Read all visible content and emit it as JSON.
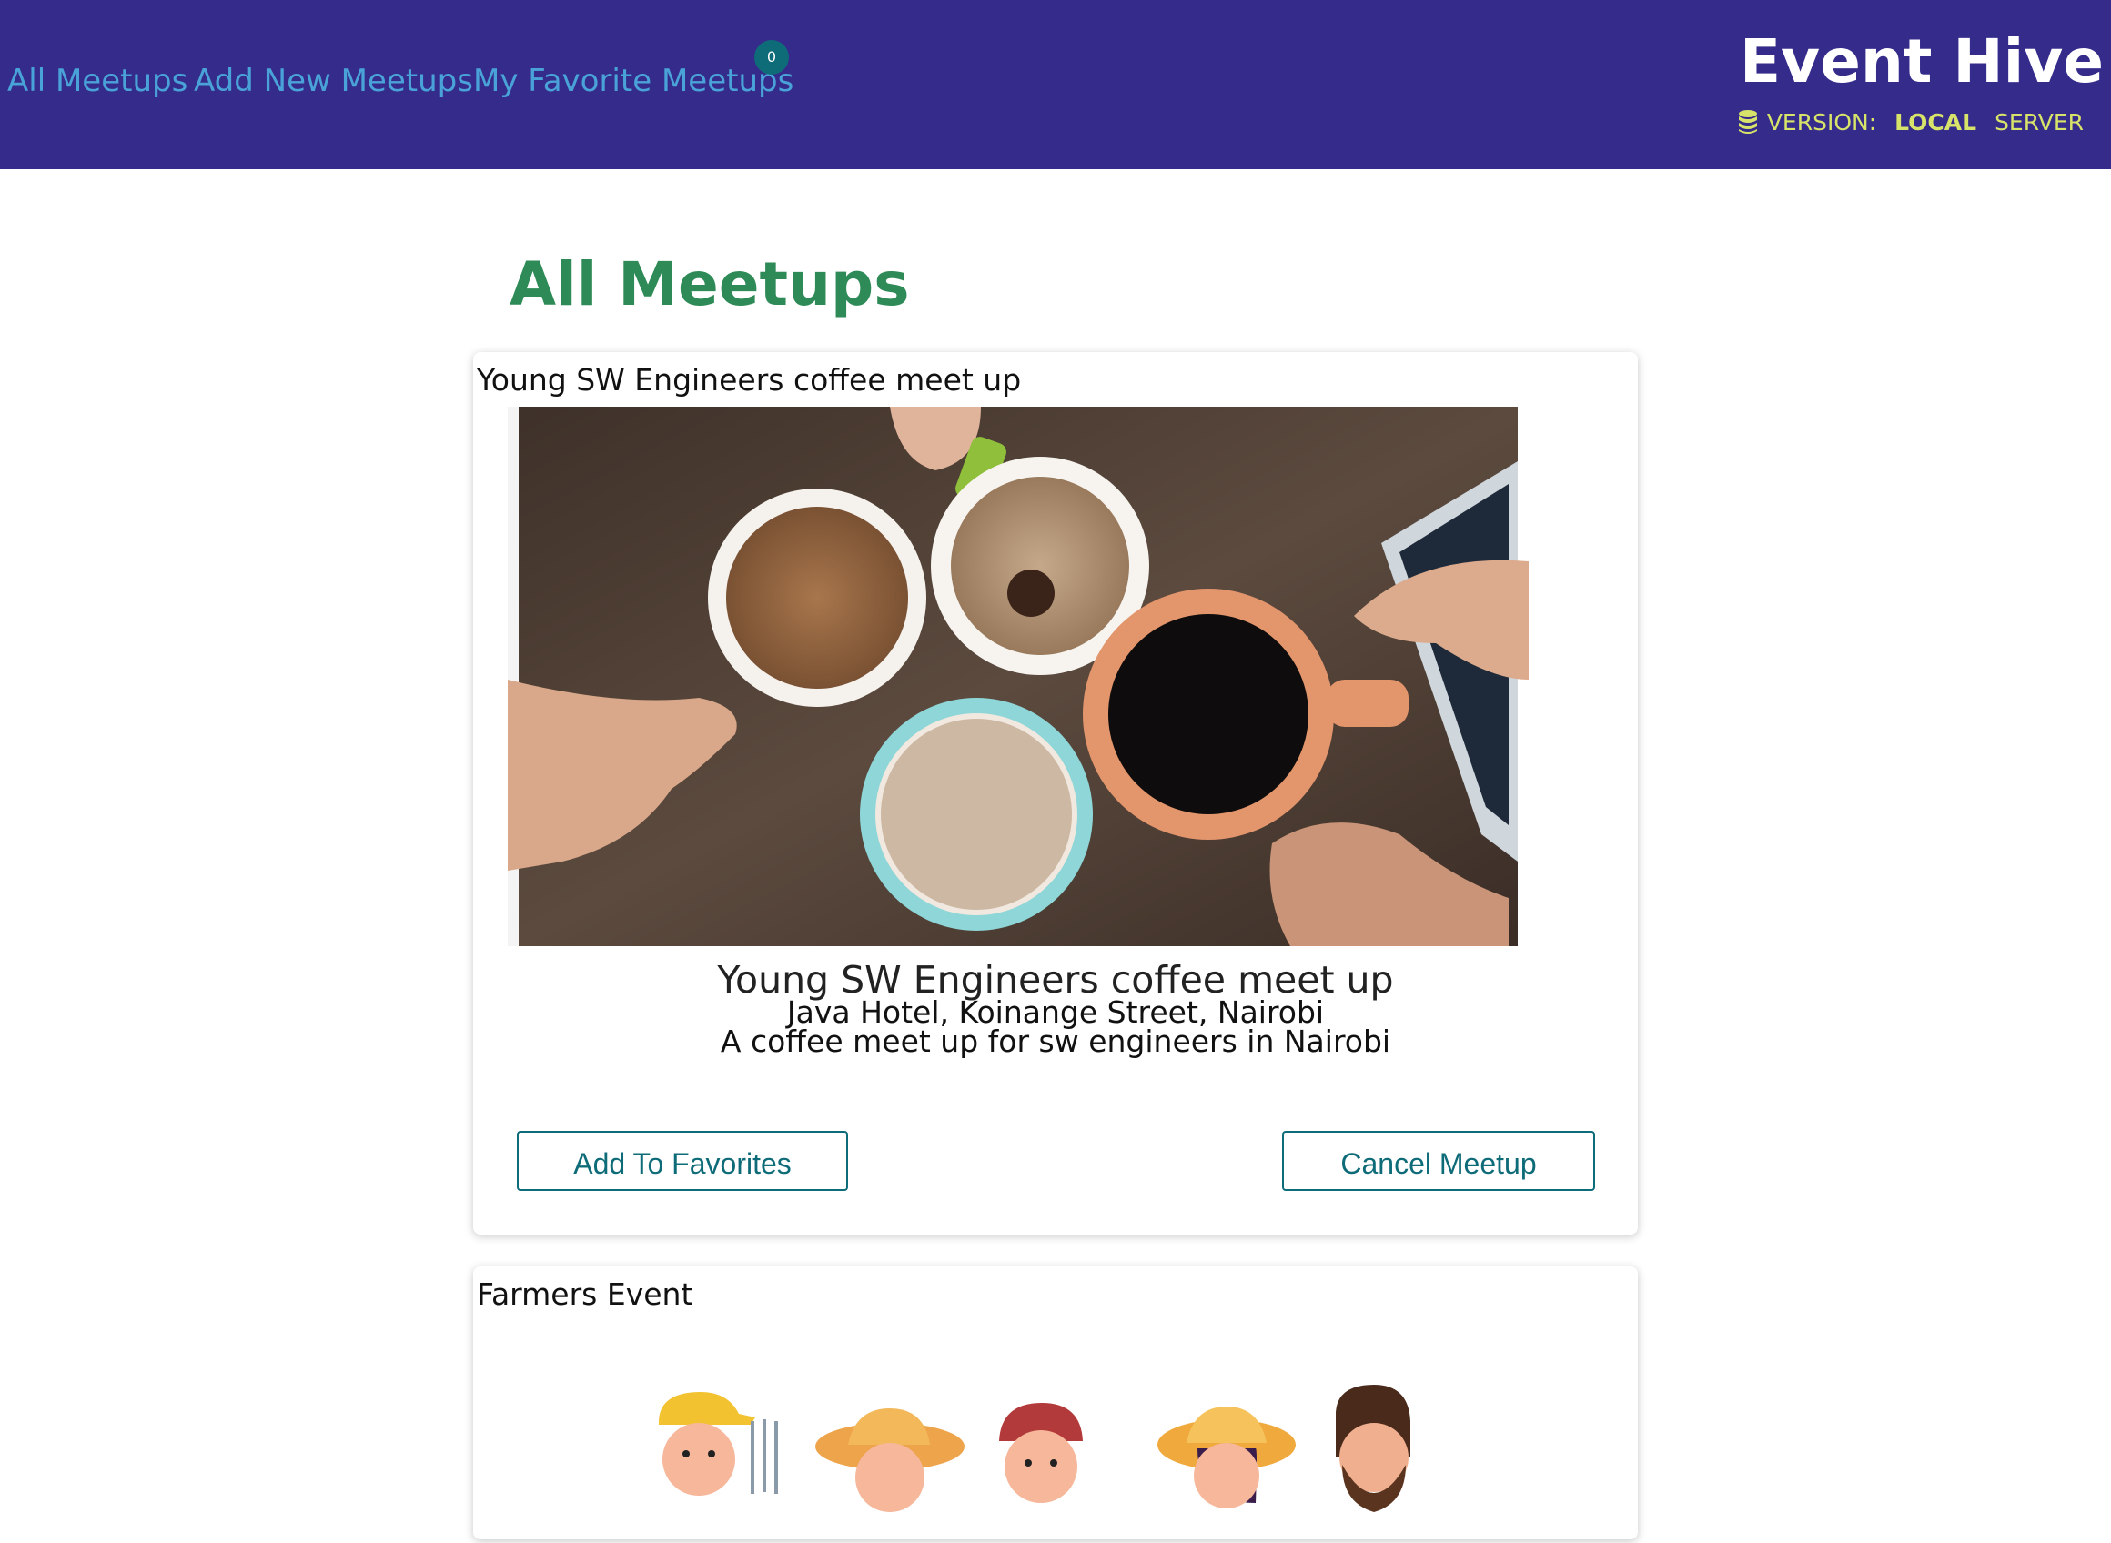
{
  "header": {
    "nav": [
      {
        "label": "All Meetups"
      },
      {
        "label": "Add New Meetups"
      },
      {
        "label": "My Favorite Meetups"
      }
    ],
    "favorites_count": "0",
    "brand": "Event Hive",
    "version": {
      "label": "VERSION:",
      "options": [
        "LOCAL",
        "SERVER"
      ],
      "selected": "LOCAL",
      "icon": "database-icon"
    }
  },
  "main": {
    "title": "All Meetups",
    "meetups": [
      {
        "header": "Young SW Engineers coffee meet up",
        "title": "Young SW Engineers coffee meet up",
        "address": "Java Hotel, Koinange Street, Nairobi",
        "description": "A coffee meet up for sw engineers in Nairobi",
        "add_favorite_label": "Add To Favorites",
        "cancel_label": "Cancel Meetup"
      },
      {
        "header": "Farmers Event"
      }
    ]
  },
  "colors": {
    "header_bg": "#352b8a",
    "nav_link": "#4aa3d8",
    "badge_bg": "#0e6b78",
    "version_text": "#d8e36a",
    "page_title": "#2e8a56",
    "button": "#0e6b78"
  }
}
